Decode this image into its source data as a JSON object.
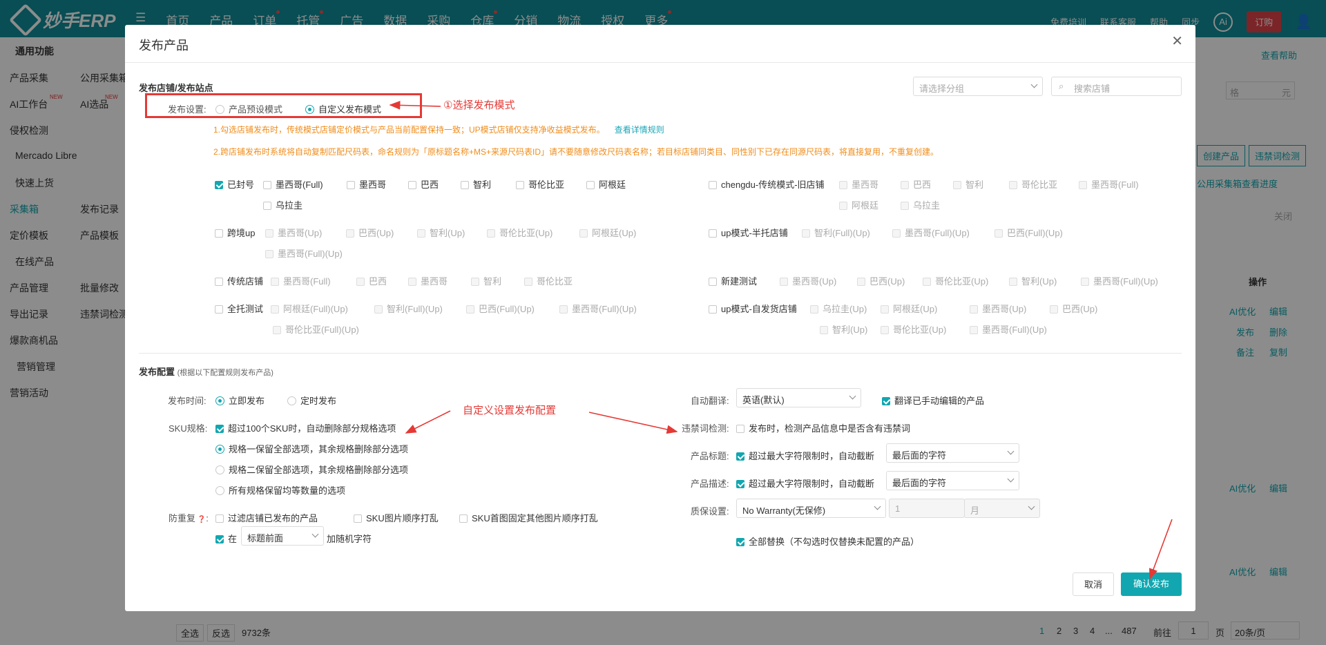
{
  "app": {
    "logo": "妙手ERP",
    "nav": [
      "首页",
      "产品",
      "订单",
      "托管",
      "广告",
      "数据",
      "采购",
      "仓库",
      "分销",
      "物流",
      "授权",
      "更多"
    ],
    "top_right": [
      "免费培训",
      "联系客服",
      "帮助",
      "同步",
      "Ai",
      "订购"
    ]
  },
  "sidebar": [
    "通用功能",
    "产品采集",
    "公用采集箱",
    "AI工作台",
    "AI选品",
    "侵权检测",
    "Mercado Libre",
    "快速上货",
    "采集箱",
    "发布记录",
    "定价模板",
    "产品模板",
    "在线产品",
    "产品管理",
    "批量修改",
    "导出记录",
    "违禁词检测",
    "爆款商机品",
    "营销管理",
    "营销活动"
  ],
  "new_badge": "NEW",
  "background": {
    "help": "查看帮助",
    "create": "创建产品",
    "ban_check": "违禁词检测",
    "progress": "公用采集箱查看进度",
    "close": "关闭",
    "ops": "操作",
    "ai_opt": "AI优化",
    "edit": "编辑",
    "publish": "发布",
    "delete": "删除",
    "note": "备注",
    "copy": "复制",
    "select_all": "全选",
    "invert": "反选",
    "count": "9732条",
    "pages": [
      "1",
      "2",
      "3",
      "4",
      "...",
      "487"
    ],
    "goto": "前往",
    "page": "页",
    "page_val": "1",
    "per_page": "20条/页",
    "price_ph": "格",
    "unit": "元"
  },
  "modal": {
    "title": "发布产品",
    "section1": "发布店铺/发布站点",
    "group_ph": "请选择分组",
    "search_ph": "搜索店铺",
    "mode_label": "发布设置:",
    "mode_preset": "产品预设模式",
    "mode_custom": "自定义发布模式",
    "note1": "1.勾选店铺发布时，传统模式店铺定价模式与产品当前配置保持一致；UP模式店铺仅支持净收益模式发布。",
    "note1_link": "查看详情规则",
    "note2": "2.跨店铺发布时系统将自动复制匹配尺码表，命名规则为「原标题名称+MS+来源尺码表ID」请不要随意修改尺码表名称；若目标店铺同类目、同性别下已存在同源尺码表，将直接复用，不重复创建。",
    "shops_left": [
      {
        "name": "已封号",
        "checked": true,
        "sites": [
          "墨西哥(Full)",
          "墨西哥",
          "巴西",
          "智利",
          "哥伦比亚",
          "阿根廷",
          "乌拉圭"
        ],
        "disabled": false
      },
      {
        "name": "跨境up",
        "checked": false,
        "sites": [
          "墨西哥(Up)",
          "巴西(Up)",
          "智利(Up)",
          "哥伦比亚(Up)",
          "阿根廷(Up)",
          "墨西哥(Full)(Up)"
        ],
        "disabled": true
      },
      {
        "name": "传统店铺",
        "checked": false,
        "sites": [
          "墨西哥(Full)",
          "巴西",
          "墨西哥",
          "智利",
          "哥伦比亚"
        ],
        "disabled": true
      },
      {
        "name": "全托测试",
        "checked": false,
        "sites": [
          "阿根廷(Full)(Up)",
          "智利(Full)(Up)",
          "巴西(Full)(Up)",
          "墨西哥(Full)(Up)",
          "哥伦比亚(Full)(Up)"
        ],
        "disabled": true
      }
    ],
    "shops_right": [
      {
        "name": "chengdu-传统模式-旧店铺",
        "sites": [
          "墨西哥",
          "巴西",
          "智利",
          "哥伦比亚",
          "墨西哥(Full)",
          "阿根廷",
          "乌拉圭"
        ]
      },
      {
        "name": "up模式-半托店铺",
        "sites": [
          "智利(Full)(Up)",
          "墨西哥(Full)(Up)",
          "巴西(Full)(Up)"
        ]
      },
      {
        "name": "新建测试",
        "sites": [
          "墨西哥(Up)",
          "巴西(Up)",
          "哥伦比亚(Up)",
          "智利(Up)",
          "墨西哥(Full)(Up)"
        ]
      },
      {
        "name": "up模式-自发货店铺",
        "sites": [
          "乌拉圭(Up)",
          "阿根廷(Up)",
          "墨西哥(Up)",
          "巴西(Up)",
          "智利(Up)",
          "哥伦比亚(Up)",
          "墨西哥(Full)(Up)"
        ]
      }
    ],
    "section2": "发布配置",
    "section2_hint": "(根据以下配置规则发布产品)",
    "time_label": "发布时间:",
    "time_now": "立即发布",
    "time_sched": "定时发布",
    "sku_label": "SKU规格:",
    "sku_auto": "超过100个SKU时，自动删除部分规格选项",
    "sku_opt1": "规格一保留全部选项，其余规格删除部分选项",
    "sku_opt2": "规格二保留全部选项，其余规格删除部分选项",
    "sku_opt3": "所有规格保留均等数量的选项",
    "dup_label": "防重复",
    "dup_filter": "过滤店铺已发布的产品",
    "dup_img": "SKU图片顺序打乱",
    "dup_first": "SKU首图固定其他图片顺序打乱",
    "dup_in": "在",
    "dup_pos": "标题前面",
    "dup_rand": "加随机字符",
    "trans_label": "自动翻译:",
    "trans_val": "英语(默认)",
    "trans_manual": "翻译已手动编辑的产品",
    "ban_label": "违禁词检测:",
    "ban_text": "发布时，检测产品信息中是否含有违禁词",
    "ptitle_label": "产品标题:",
    "ptitle_text": "超过最大字符限制时，自动截断",
    "ptitle_sel": "最后面的字符",
    "pdesc_label": "产品描述:",
    "pdesc_text": "超过最大字符限制时，自动截断",
    "pdesc_sel": "最后面的字符",
    "warranty_label": "质保设置:",
    "warranty_val": "No Warranty(无保修)",
    "warranty_num": "1",
    "warranty_unit": "月",
    "replace_all": "全部替换（不勾选时仅替换未配置的产品）",
    "cancel": "取消",
    "confirm": "确认发布"
  },
  "annotations": {
    "select_mode": "①选择发布模式",
    "custom_config": "自定义设置发布配置"
  },
  "colors": {
    "teal": "#0f8f9a",
    "accent": "#12a7b0",
    "annotation": "#e53935",
    "warning": "#f08c1a"
  }
}
